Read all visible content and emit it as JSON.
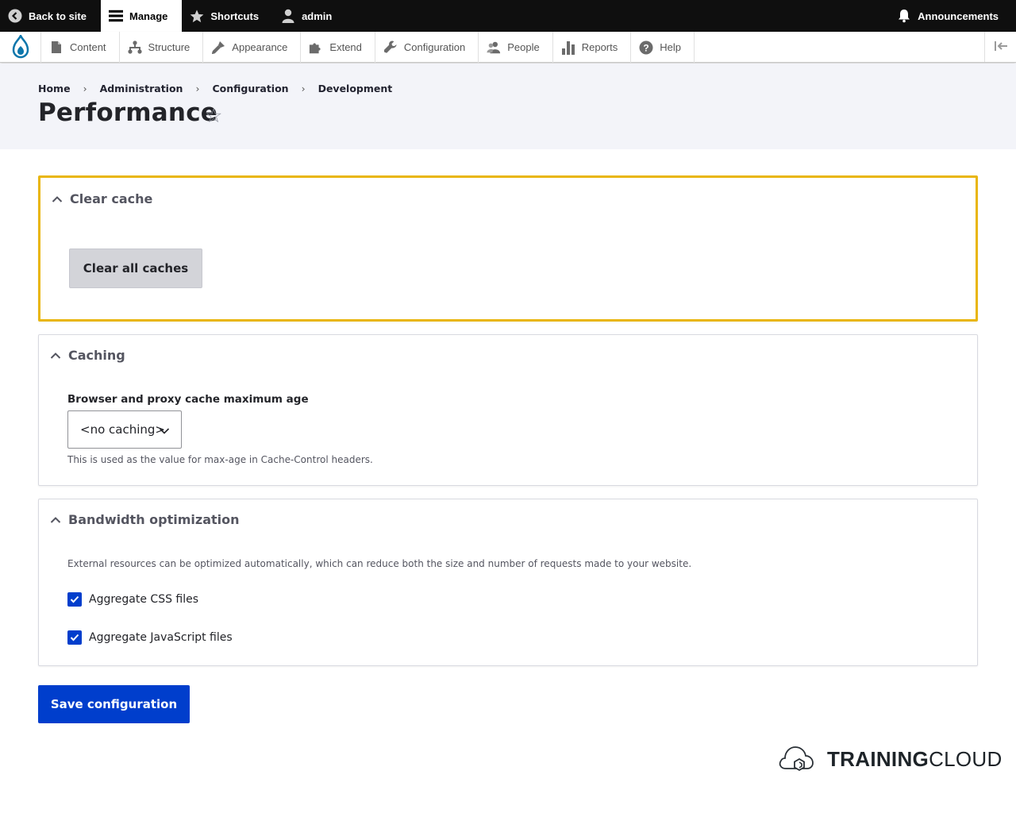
{
  "toolbar": {
    "back_to_site": "Back to site",
    "manage": "Manage",
    "shortcuts": "Shortcuts",
    "user": "admin",
    "announcements": "Announcements"
  },
  "admin_menu": {
    "items": [
      {
        "label": "Content",
        "icon": "document-icon"
      },
      {
        "label": "Structure",
        "icon": "sitemap-icon"
      },
      {
        "label": "Appearance",
        "icon": "paintbrush-icon"
      },
      {
        "label": "Extend",
        "icon": "puzzle-icon"
      },
      {
        "label": "Configuration",
        "icon": "wrench-icon"
      },
      {
        "label": "People",
        "icon": "people-icon"
      },
      {
        "label": "Reports",
        "icon": "bar-chart-icon"
      },
      {
        "label": "Help",
        "icon": "help-icon"
      }
    ]
  },
  "breadcrumb": [
    "Home",
    "Administration",
    "Configuration",
    "Development"
  ],
  "page": {
    "title": "Performance"
  },
  "clear_cache": {
    "summary": "Clear cache",
    "button": "Clear all caches"
  },
  "caching": {
    "summary": "Caching",
    "field_label": "Browser and proxy cache maximum age",
    "selected": "<no caching>",
    "description": "This is used as the value for max-age in Cache-Control headers."
  },
  "bandwidth": {
    "summary": "Bandwidth optimization",
    "description": "External resources can be optimized automatically, which can reduce both the size and number of requests made to your website.",
    "aggregate_css": {
      "label": "Aggregate CSS files",
      "checked": true
    },
    "aggregate_js": {
      "label": "Aggregate JavaScript files",
      "checked": true
    }
  },
  "actions": {
    "save": "Save configuration"
  },
  "brand": {
    "bold": "TRAINING",
    "light": "CLOUD"
  },
  "colors": {
    "primary": "#003ecc",
    "focus": "#e9b60e",
    "toolbar": "#0f0f0f"
  }
}
